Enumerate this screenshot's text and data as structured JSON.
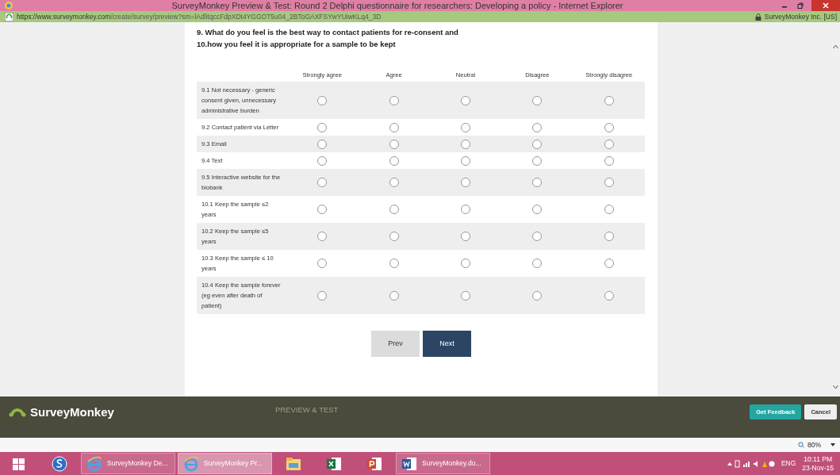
{
  "window": {
    "title": "SurveyMonkey Preview & Test: Round 2 Delphi questionnaire for researchers: Developing a policy  - Internet Explorer"
  },
  "address_bar": {
    "url_host": "https://www.surveymonkey.com",
    "url_path": "/create/survey/preview?sm=lAdlitqccFdpXDt4YGGOT5u04_2BToGAXFSYwYUiwKLq4_3D",
    "site_identity": "SurveyMonkey Inc. [US]"
  },
  "question": {
    "title_lines": [
      "9. What do you feel is the best way to contact patients for re-consent and",
      "10.how you feel it is appropriate for a sample to be kept"
    ],
    "columns": [
      "Strongly agree",
      "Agree",
      "Neutral",
      "Disagree",
      "Strongly disagree"
    ],
    "rows": [
      {
        "label": "9.1 Not necessary - generic consent given, unnecessary administrative burden",
        "options": [
          {
            "selected": false
          },
          {
            "selected": false
          },
          {
            "selected": false
          },
          {
            "selected": false
          },
          {
            "selected": false
          }
        ]
      },
      {
        "label": "9.2 Contact patient via Letter",
        "options": [
          {
            "selected": false
          },
          {
            "selected": false
          },
          {
            "selected": false
          },
          {
            "selected": false
          },
          {
            "selected": false
          }
        ]
      },
      {
        "label": "9.3 Email",
        "options": [
          {
            "selected": false
          },
          {
            "selected": false
          },
          {
            "selected": false
          },
          {
            "selected": false
          },
          {
            "selected": false
          }
        ]
      },
      {
        "label": "9.4 Text",
        "options": [
          {
            "selected": false
          },
          {
            "selected": false
          },
          {
            "selected": false
          },
          {
            "selected": false
          },
          {
            "selected": false
          }
        ]
      },
      {
        "label": "9.5 Interactive website for the biobank",
        "options": [
          {
            "selected": false
          },
          {
            "selected": false
          },
          {
            "selected": false
          },
          {
            "selected": false
          },
          {
            "selected": false
          }
        ]
      },
      {
        "label": "10.1 Keep the sample ≤2 years",
        "options": [
          {
            "selected": false
          },
          {
            "selected": false
          },
          {
            "selected": false
          },
          {
            "selected": false
          },
          {
            "selected": false
          }
        ]
      },
      {
        "label": "10.2 Keep the sample ≤5 years",
        "options": [
          {
            "selected": false
          },
          {
            "selected": false
          },
          {
            "selected": false
          },
          {
            "selected": false
          },
          {
            "selected": false
          }
        ]
      },
      {
        "label": "10.3 Keep the sample ≤ 10 years",
        "options": [
          {
            "selected": false
          },
          {
            "selected": false
          },
          {
            "selected": false
          },
          {
            "selected": false
          },
          {
            "selected": false
          }
        ]
      },
      {
        "label": "10.4 Keep the sample forever (eg even after death of patient)",
        "options": [
          {
            "selected": false
          },
          {
            "selected": false
          },
          {
            "selected": false
          },
          {
            "selected": false
          },
          {
            "selected": false
          }
        ]
      }
    ]
  },
  "nav_buttons": [
    {
      "label": "Prev",
      "kind": "secondary"
    },
    {
      "label": "Next",
      "kind": "primary"
    }
  ],
  "footer": {
    "logo": "SurveyMonkey",
    "mode": "PREVIEW & TEST",
    "buttons": [
      {
        "label": "Get Feedback",
        "kind": "primary"
      },
      {
        "label": "Cancel",
        "kind": "secondary"
      }
    ]
  },
  "zoom": "80%",
  "taskbar": {
    "items": [
      {
        "kind": "start"
      },
      {
        "kind": "skype"
      },
      {
        "kind": "ie",
        "label": "SurveyMonkey De...",
        "selected": false
      },
      {
        "kind": "ie",
        "label": "SurveyMonkey Pr...",
        "selected": true
      },
      {
        "kind": "explorer"
      },
      {
        "kind": "excel"
      },
      {
        "kind": "powerpoint"
      },
      {
        "kind": "word",
        "label": "SurveyMonkey.do...",
        "selected": false
      }
    ],
    "language": "ENG",
    "time": "10:11 PM",
    "date": "23-Nov-15"
  }
}
